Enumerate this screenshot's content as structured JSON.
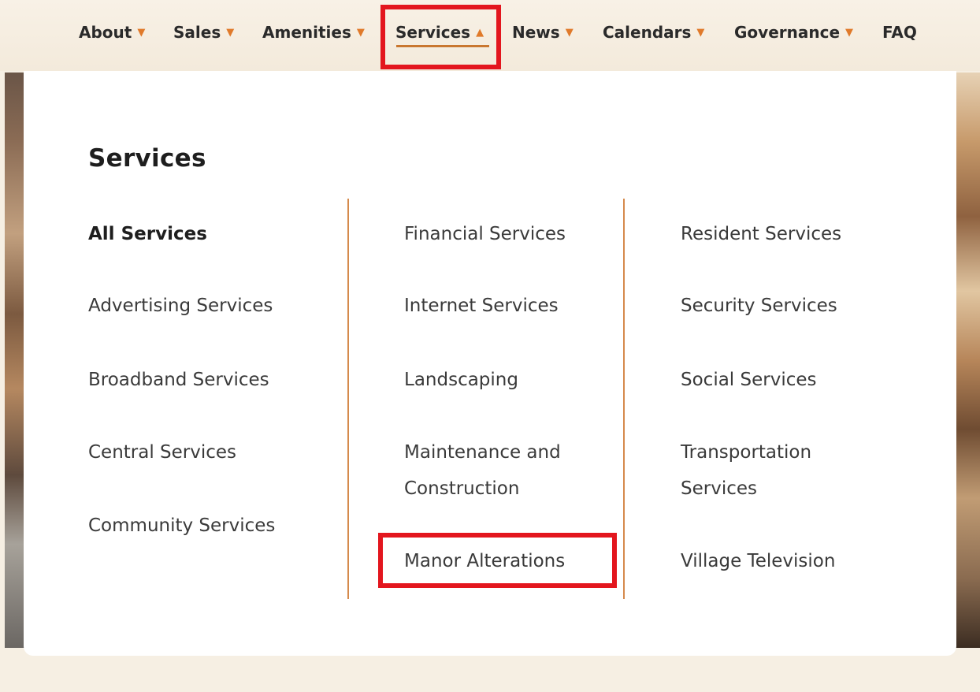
{
  "nav": {
    "items": [
      {
        "label": "About",
        "caret": "▼"
      },
      {
        "label": "Sales",
        "caret": "▼"
      },
      {
        "label": "Amenities",
        "caret": "▼"
      },
      {
        "label": "Services",
        "caret": "▲"
      },
      {
        "label": "News",
        "caret": "▼"
      },
      {
        "label": "Calendars",
        "caret": "▼"
      },
      {
        "label": "Governance",
        "caret": "▼"
      },
      {
        "label": "FAQ"
      }
    ],
    "active": "Services",
    "caret_color": "#e07a2a"
  },
  "dropdown": {
    "title": "Services",
    "columns": [
      [
        "All Services",
        "Advertising Services",
        "Broadband Services",
        "Central Services",
        "Community Services"
      ],
      [
        "Financial Services",
        "Internet Services",
        "Landscaping",
        "Maintenance and Construction",
        "Manor Alterations"
      ],
      [
        "Resident Services",
        "Security Services",
        "Social Services",
        "Transportation Services",
        "Village Television"
      ]
    ],
    "divider_color": "#d58a4c"
  },
  "highlight_color": "#e3161e"
}
